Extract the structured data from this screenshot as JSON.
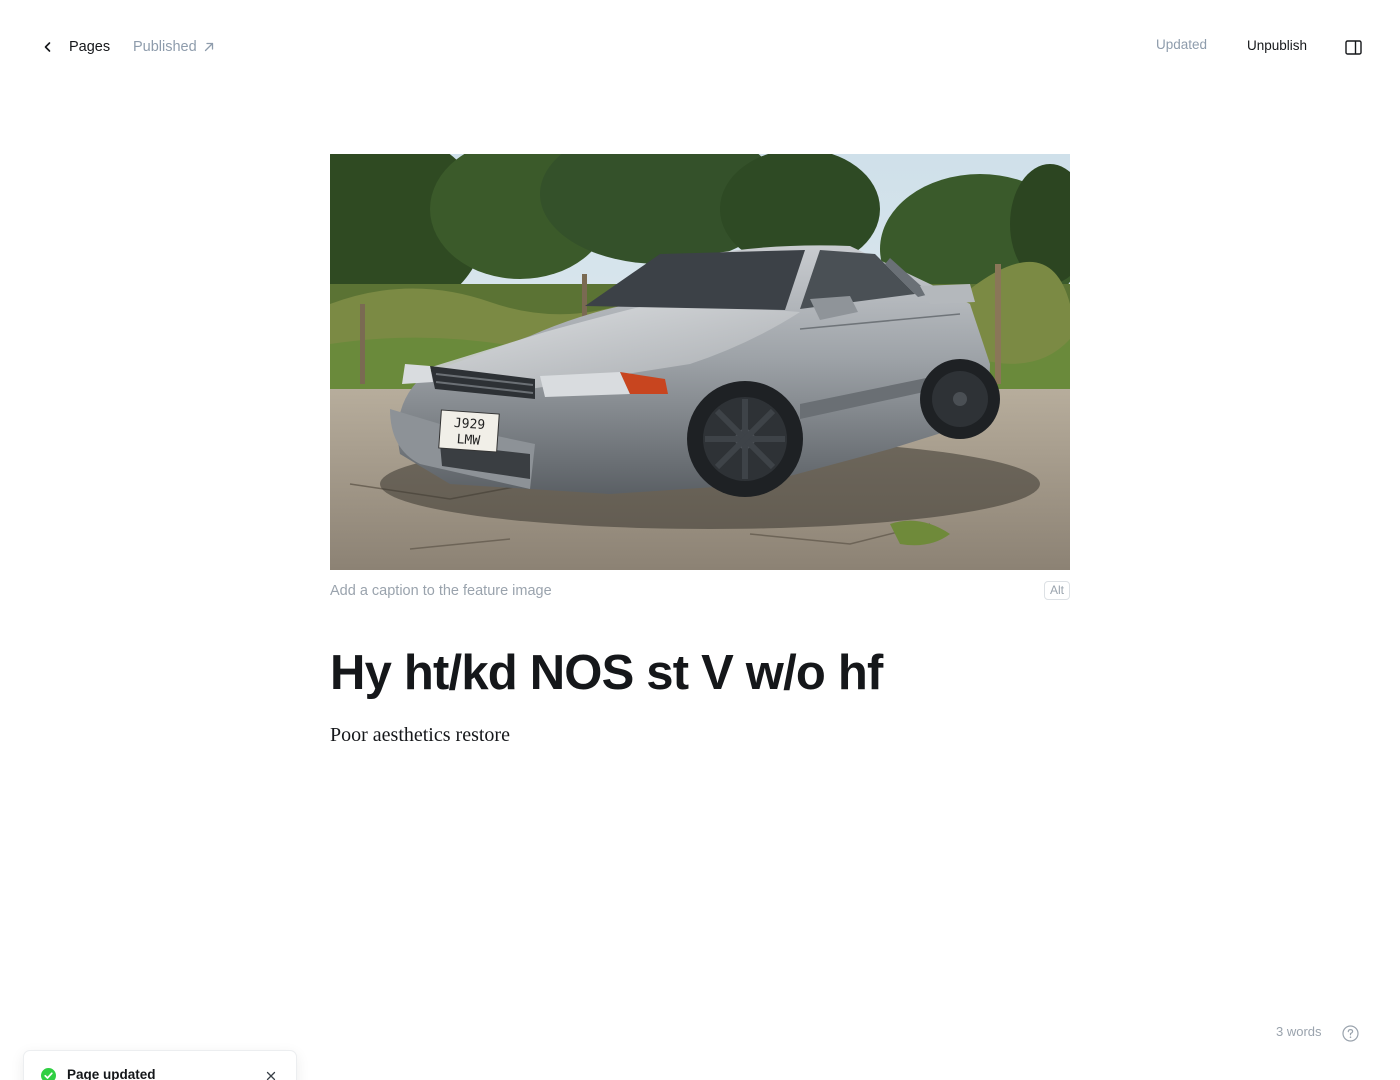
{
  "topbar": {
    "back_label": "Pages",
    "status_label": "Published",
    "updated_label": "Updated",
    "unpublish_label": "Unpublish",
    "icons": {
      "back": "chevron-left-icon",
      "status": "arrow-up-right-icon",
      "sidebar": "sidebar-toggle-icon"
    }
  },
  "feature_image": {
    "caption_placeholder": "Add a caption to the feature image",
    "caption_value": "",
    "alt_label": "Alt",
    "plate_text": [
      "J929",
      "LMW"
    ]
  },
  "post": {
    "title": "Hy ht/kd NOS st V w/o hf",
    "body": "Poor aesthetics restore"
  },
  "footer": {
    "word_count": "3 words",
    "help_icon": "question-circle-icon"
  },
  "toast": {
    "label": "Page updated",
    "icon": "check-circle-icon",
    "close_icon": "close-icon",
    "accent": "#30cf43"
  },
  "colors": {
    "text": "#15171a",
    "muted": "#8e9cac",
    "success": "#30cf43"
  }
}
